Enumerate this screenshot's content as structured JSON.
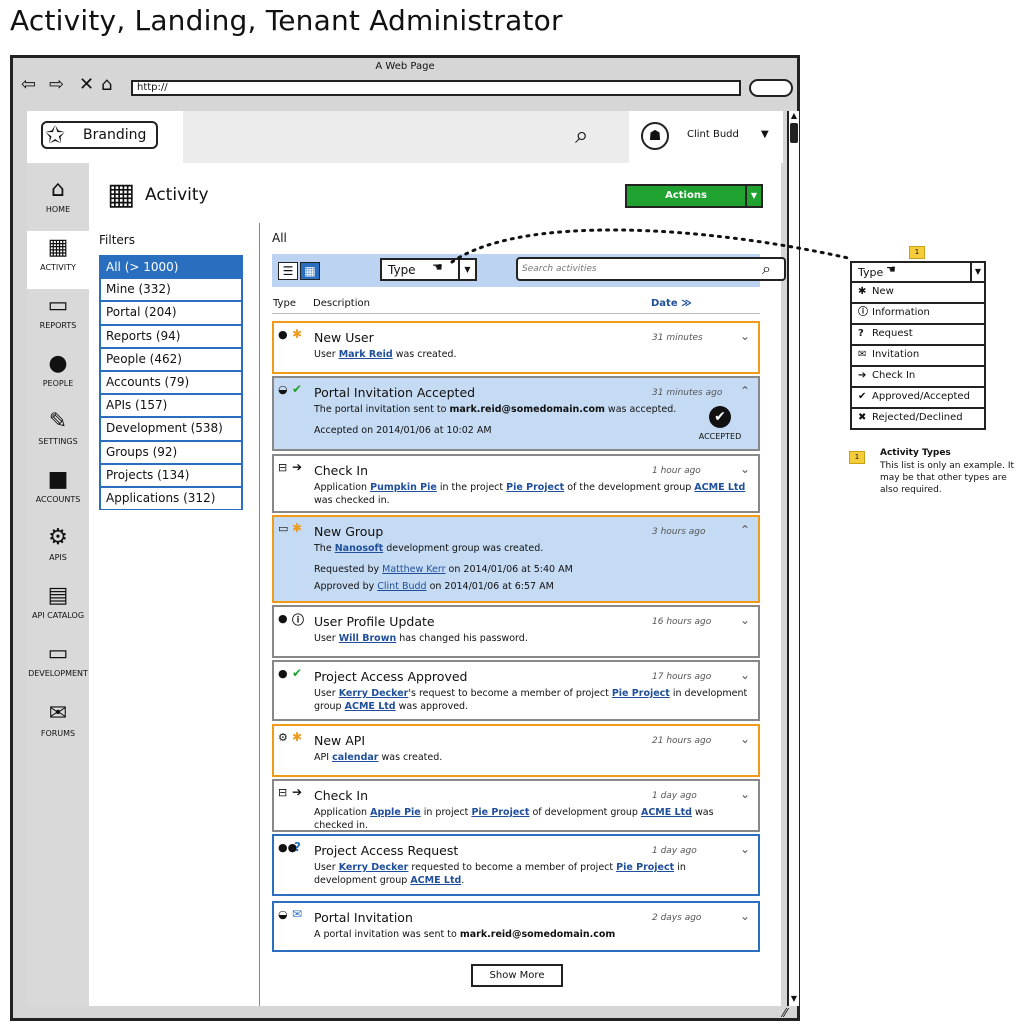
{
  "page_title": "Activity, Landing, Tenant Administrator",
  "browser": {
    "window_title": "A Web Page",
    "url": "http://",
    "back_icon": "back-arrow-icon",
    "forward_icon": "forward-arrow-icon",
    "stop_icon": "close-icon",
    "home_icon": "home-icon"
  },
  "header": {
    "brand_label": "Branding",
    "user_name": "Clint Budd",
    "search_icon": "search-icon",
    "avatar_icon": "android-icon"
  },
  "nav": [
    {
      "label": "HOME",
      "icon": "home-icon",
      "glyph": "⌂"
    },
    {
      "label": "ACTIVITY",
      "icon": "calendar-icon",
      "glyph": "▦"
    },
    {
      "label": "REPORTS",
      "icon": "inbox-icon",
      "glyph": "▭"
    },
    {
      "label": "PEOPLE",
      "icon": "person-icon",
      "glyph": "●"
    },
    {
      "label": "SETTINGS",
      "icon": "wrench-icon",
      "glyph": "✎"
    },
    {
      "label": "ACCOUNTS",
      "icon": "archive-icon",
      "glyph": "■"
    },
    {
      "label": "APIS",
      "icon": "gears-icon",
      "glyph": "⚙"
    },
    {
      "label": "API CATALOG",
      "icon": "book-icon",
      "glyph": "▤"
    },
    {
      "label": "DEVELOPMENT",
      "icon": "monitor-icon",
      "glyph": "▭"
    },
    {
      "label": "FORUMS",
      "icon": "comments-icon",
      "glyph": "✉"
    }
  ],
  "content": {
    "title": "Activity",
    "actions_label": "Actions",
    "filters_title": "Filters",
    "list_title": "All",
    "type_select_value": "Type",
    "search_placeholder": "Search activities",
    "col_type": "Type",
    "col_description": "Description",
    "col_date": "Date ≫",
    "show_more": "Show More"
  },
  "filters": [
    "All (> 1000)",
    "Mine (332)",
    "Portal (204)",
    "Reports (94)",
    "People (462)",
    "Accounts (79)",
    "APIs (157)",
    "Development (538)",
    "Groups (92)",
    "Projects (134)",
    "Applications (312)"
  ],
  "activities": {
    "a1": {
      "title": "New User",
      "time": "31 minutes",
      "t1": "User ",
      "l1": "Mark Reid",
      "t2": " was created."
    },
    "a2": {
      "title": "Portal Invitation Accepted",
      "time": "31 minutes ago",
      "t1": "The portal invitation sent to ",
      "b1": "mark.reid@somedomain.com",
      "t2": " was accepted.",
      "line2": "Accepted on 2014/01/06 at 10:02 AM",
      "badge": "ACCEPTED"
    },
    "a3": {
      "title": "Check In",
      "time": "1 hour ago",
      "t1": "Application ",
      "l1": "Pumpkin Pie",
      "t2": " in the project ",
      "l2": "Pie Project",
      "t3": " of the development group ",
      "l3": "ACME Ltd",
      "t4": " was checked in."
    },
    "a4": {
      "title": "New Group",
      "time": "3 hours ago",
      "t1": "The ",
      "l1": "Nanosoft",
      "t2": " development group was created.",
      "r1": "Requested by ",
      "rl1": "Matthew Kerr",
      "r2": " on 2014/01/06 at 5:40 AM",
      "p1": "Approved by ",
      "pl1": "Clint Budd",
      "p2": " on 2014/01/06 at 6:57 AM"
    },
    "a5": {
      "title": "User Profile Update",
      "time": "16 hours ago",
      "t1": "User ",
      "l1": "Will Brown",
      "t2": " has changed his password."
    },
    "a6": {
      "title": "Project Access Approved",
      "time": "17 hours ago",
      "t1": "User ",
      "l1": "Kerry Decker",
      "t2": "'s request to become a member of project ",
      "l2": "Pie Project",
      "t3": " in development group ",
      "l3": "ACME Ltd",
      "t4": " was approved."
    },
    "a7": {
      "title": "New API",
      "time": "21 hours ago",
      "t1": "API ",
      "l1": "calendar",
      "t2": " was created."
    },
    "a8": {
      "title": "Check In",
      "time": "1 day ago",
      "t1": "Application ",
      "l1": "Apple Pie",
      "t2": " in project ",
      "l2": "Pie Project",
      "t3": " of development group ",
      "l3": "ACME Ltd",
      "t4": " was checked in."
    },
    "a9": {
      "title": "Project Access Request",
      "time": "1 day ago",
      "t1": "User ",
      "l1": "Kerry Decker",
      "t2": " requested to become a member of project ",
      "l2": "Pie Project",
      "t3": " in development group ",
      "l3": "ACME Ltd",
      "t4": "."
    },
    "a10": {
      "title": "Portal Invitation",
      "time": "2 days ago",
      "t1": "A portal invitation was sent to ",
      "b1": "mark.reid@somedomain.com"
    }
  },
  "annotation": {
    "marker": "1",
    "type_label": "Type",
    "options": [
      {
        "glyph": "✱",
        "label": "New"
      },
      {
        "glyph": "ⓘ",
        "label": "Information"
      },
      {
        "glyph": "?",
        "label": "Request"
      },
      {
        "glyph": "✉",
        "label": "Invitation"
      },
      {
        "glyph": "➔",
        "label": "Check In"
      },
      {
        "glyph": "✔",
        "label": "Approved/Accepted"
      },
      {
        "glyph": "✖",
        "label": "Rejected/Declined"
      }
    ],
    "note_title": "Activity Types",
    "note_body": "This list is only an example. It may be that other types are also required."
  },
  "colors": {
    "accent_blue": "#2a6fbf",
    "highlight_blue": "#c5daf3",
    "action_green": "#1fa22f",
    "new_orange": "#f09a1a"
  }
}
